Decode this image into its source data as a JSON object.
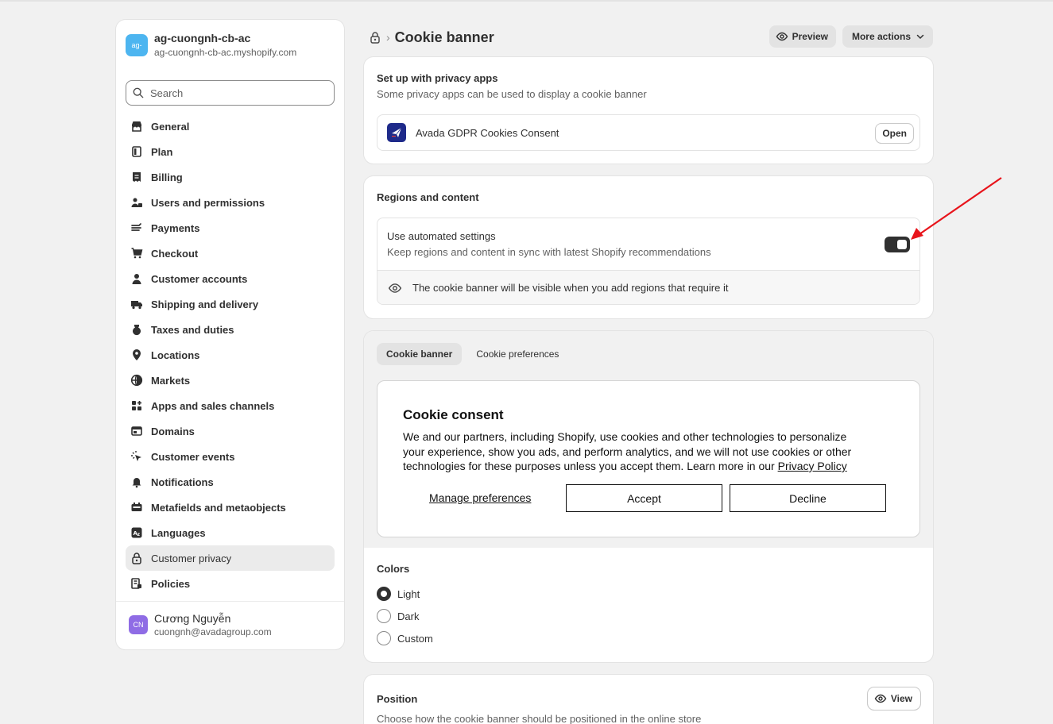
{
  "store": {
    "avatar": "ag-",
    "name": "ag-cuongnh-cb-ac",
    "url": "ag-cuongnh-cb-ac.myshopify.com"
  },
  "search": {
    "placeholder": "Search"
  },
  "nav": [
    {
      "label": "General",
      "icon": "store-icon"
    },
    {
      "label": "Plan",
      "icon": "plan-icon"
    },
    {
      "label": "Billing",
      "icon": "billing-icon"
    },
    {
      "label": "Users and permissions",
      "icon": "users-icon"
    },
    {
      "label": "Payments",
      "icon": "payments-icon"
    },
    {
      "label": "Checkout",
      "icon": "cart-icon"
    },
    {
      "label": "Customer accounts",
      "icon": "person-icon"
    },
    {
      "label": "Shipping and delivery",
      "icon": "truck-icon"
    },
    {
      "label": "Taxes and duties",
      "icon": "tax-icon"
    },
    {
      "label": "Locations",
      "icon": "location-icon"
    },
    {
      "label": "Markets",
      "icon": "globe-icon"
    },
    {
      "label": "Apps and sales channels",
      "icon": "apps-icon"
    },
    {
      "label": "Domains",
      "icon": "domain-icon"
    },
    {
      "label": "Customer events",
      "icon": "cursor-icon"
    },
    {
      "label": "Notifications",
      "icon": "bell-icon"
    },
    {
      "label": "Metafields and metaobjects",
      "icon": "metafields-icon"
    },
    {
      "label": "Languages",
      "icon": "language-icon"
    },
    {
      "label": "Customer privacy",
      "icon": "lock-icon",
      "active": true
    },
    {
      "label": "Policies",
      "icon": "policies-icon"
    }
  ],
  "user": {
    "initials": "CN",
    "name": "Cương Nguyễn",
    "email": "cuongnh@avadagroup.com"
  },
  "header": {
    "title": "Cookie banner",
    "preview": "Preview",
    "more_actions": "More actions"
  },
  "privacy_apps": {
    "title": "Set up with privacy apps",
    "subtitle": "Some privacy apps can be used to display a cookie banner",
    "app_name": "Avada GDPR Cookies Consent",
    "open": "Open"
  },
  "regions": {
    "title": "Regions and content",
    "auto_label": "Use automated settings",
    "auto_desc": "Keep regions and content in sync with latest Shopify recommendations",
    "toggle_on": true,
    "notice": "The cookie banner will be visible when you add regions that require it"
  },
  "tabs": {
    "banner": "Cookie banner",
    "preferences": "Cookie preferences"
  },
  "preview": {
    "title": "Cookie consent",
    "body": "We and our partners, including Shopify, use cookies and other technologies to personalize your experience, show you ads, and perform analytics, and we will not use cookies or other technologies for these purposes unless you accept them. Learn more in our ",
    "link": "Privacy Policy",
    "manage": "Manage preferences",
    "accept": "Accept",
    "decline": "Decline"
  },
  "colors": {
    "title": "Colors",
    "options": [
      "Light",
      "Dark",
      "Custom"
    ],
    "selected": "Light"
  },
  "position": {
    "title": "Position",
    "subtitle": "Choose how the cookie banner should be positioned in the online store",
    "view": "View"
  },
  "accent": {
    "dark": "#303030",
    "annotation_arrow": "#e8141b",
    "store_avatar": "#4db5f0",
    "user_avatar": "#8f6ce5"
  }
}
